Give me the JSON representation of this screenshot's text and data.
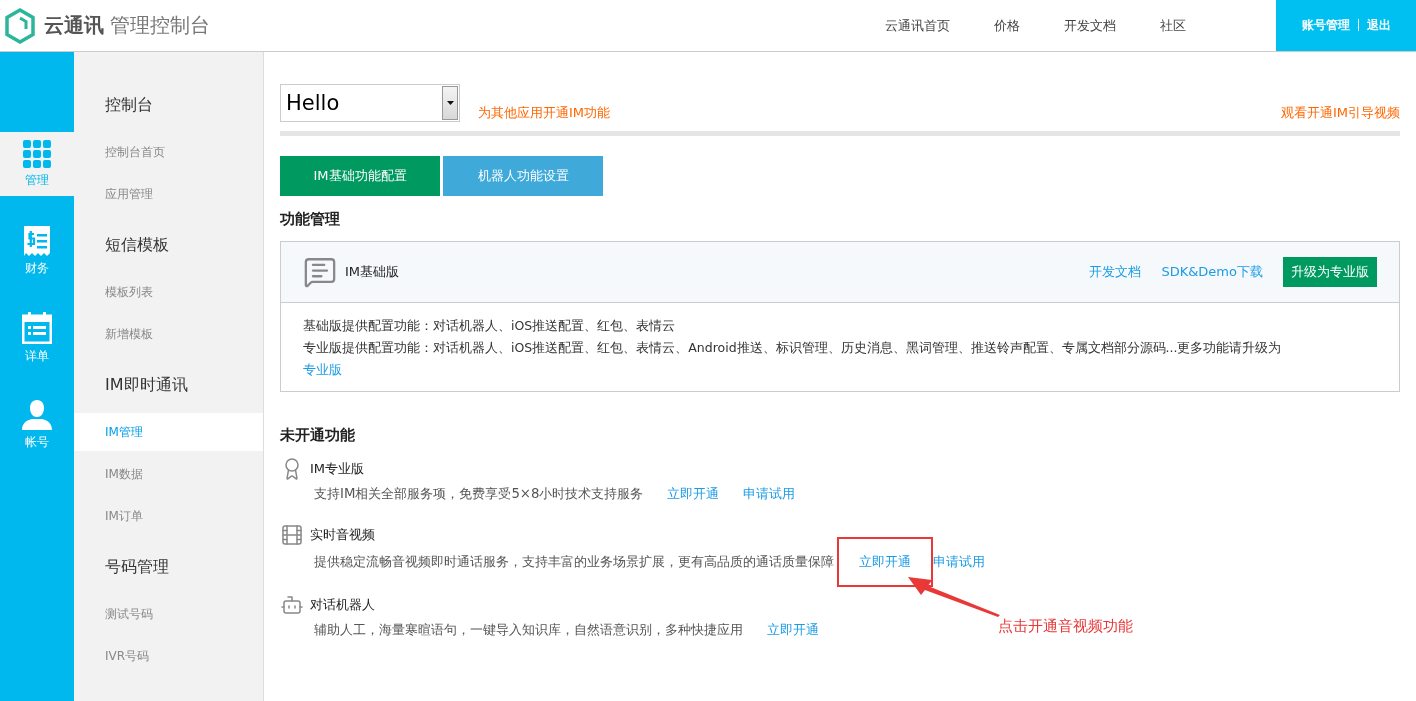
{
  "header": {
    "brand": "云通讯",
    "subtitle": "管理控制台",
    "nav": [
      "云通讯首页",
      "价格",
      "开发文档",
      "社区"
    ],
    "account": [
      "账号管理",
      "退出"
    ]
  },
  "rail": [
    {
      "kind": "grid",
      "label": "管理",
      "selected": true
    },
    {
      "kind": "receipt",
      "label": "财务",
      "selected": false
    },
    {
      "kind": "calendar",
      "label": "详单",
      "selected": false
    },
    {
      "kind": "user",
      "label": "帐号",
      "selected": false
    }
  ],
  "menu": [
    {
      "title": "控制台",
      "items": [
        {
          "label": "控制台首页",
          "selected": false
        },
        {
          "label": "应用管理",
          "selected": false
        }
      ]
    },
    {
      "title": "短信模板",
      "items": [
        {
          "label": "模板列表",
          "selected": false
        },
        {
          "label": "新增模板",
          "selected": false
        }
      ]
    },
    {
      "title": "IM即时通讯",
      "items": [
        {
          "label": "IM管理",
          "selected": true
        },
        {
          "label": "IM数据",
          "selected": false
        },
        {
          "label": "IM订单",
          "selected": false
        }
      ]
    },
    {
      "title": "号码管理",
      "items": [
        {
          "label": "测试号码",
          "selected": false
        },
        {
          "label": "IVR号码",
          "selected": false
        }
      ]
    }
  ],
  "app_select": {
    "value": "Hello"
  },
  "enable_other_link": "为其他应用开通IM功能",
  "video_link": "观看开通IM引导视频",
  "tabs": [
    {
      "label": "IM基础功能配置",
      "selected": true
    },
    {
      "label": "机器人功能设置",
      "selected": false
    }
  ],
  "feature_section": {
    "title": "功能管理",
    "card": {
      "name": "IM基础版",
      "links": [
        "开发文档",
        "SDK&Demo下载"
      ],
      "upgrade": "升级为专业版",
      "lines": [
        "基础版提供配置功能：对话机器人、iOS推送配置、红包、表情云",
        "专业版提供配置功能：对话机器人、iOS推送配置、红包、表情云、Android推送、标识管理、历史消息、黑词管理、推送铃声配置、专属文档部分源码...更多功能请升级为"
      ],
      "pro_link": "专业版"
    }
  },
  "inactive_section": {
    "title": "未开通功能",
    "items": [
      {
        "kind": "award",
        "name": "IM专业版",
        "desc": "支持IM相关全部服务项，免费享受5×8小时技术支持服务",
        "actions": [
          {
            "label": "立即开通",
            "highlighted": false
          },
          {
            "label": "申请试用",
            "highlighted": false
          }
        ]
      },
      {
        "kind": "video",
        "name": "实时音视频",
        "desc": "提供稳定流畅音视频即时通话服务，支持丰富的业务场景扩展，更有高品质的通话质量保障",
        "actions": [
          {
            "label": "立即开通",
            "highlighted": true
          },
          {
            "label": "申请试用",
            "highlighted": false
          }
        ]
      },
      {
        "kind": "robot",
        "name": "对话机器人",
        "desc": "辅助人工，海量寒暄语句，一键导入知识库，自然语意识别，多种快捷应用",
        "actions": [
          {
            "label": "立即开通",
            "highlighted": false
          }
        ]
      }
    ]
  },
  "annotation": {
    "text": "点击开通音视频功能"
  }
}
